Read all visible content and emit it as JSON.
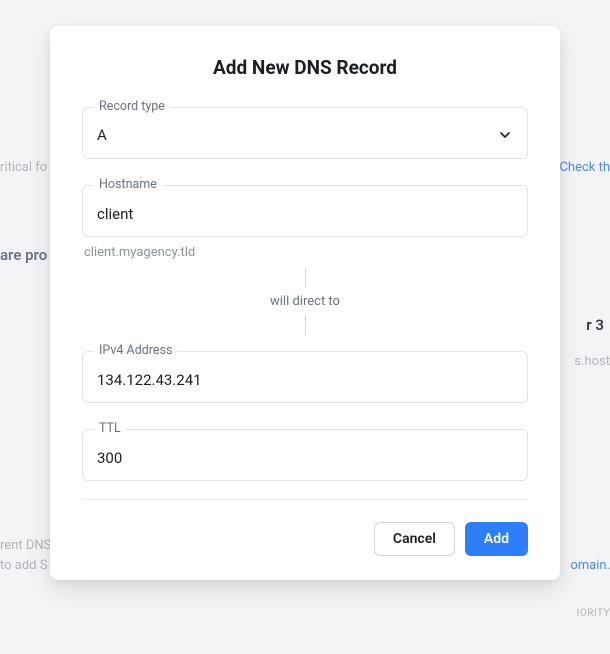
{
  "modal": {
    "title": "Add New DNS Record",
    "record_type": {
      "label": "Record type",
      "value": "A"
    },
    "hostname": {
      "label": "Hostname",
      "value": "client",
      "hint": "client.myagency.tld"
    },
    "connector_text": "will direct to",
    "ipv4": {
      "label": "IPv4 Address",
      "value": "134.122.43.241"
    },
    "ttl": {
      "label": "TTL",
      "value": "300"
    },
    "buttons": {
      "cancel": "Cancel",
      "add": "Add"
    }
  },
  "backdrop": {
    "t1": "ritical fo",
    "t2": "Check th",
    "t3": "are pro",
    "t4": "r 3",
    "t5": "s.host",
    "t6": "rent DNS",
    "t7": "to add S",
    "t8": "omain.",
    "t9": "IORITY"
  }
}
